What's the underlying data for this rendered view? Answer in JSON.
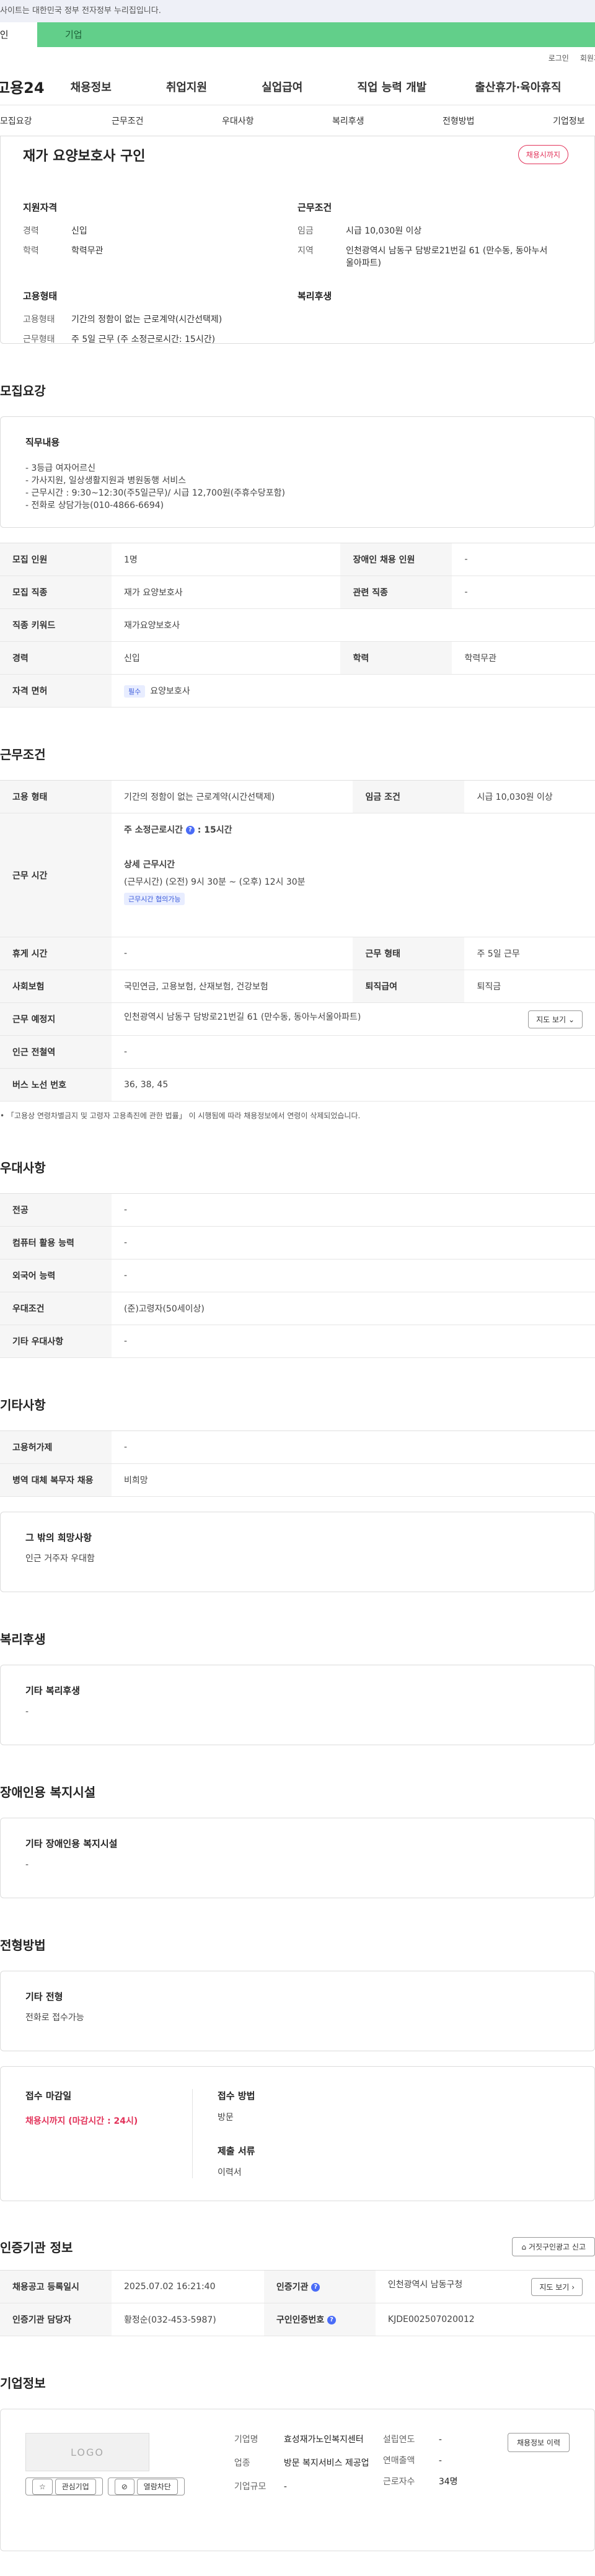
{
  "gov_notice": "사이트는 대한민국 정부 전자정부 누리집입니다.",
  "tabs": {
    "personal": "개인",
    "company": "기업"
  },
  "utility": {
    "login": "로그인",
    "signup": "회원가입"
  },
  "gnb": {
    "logo": "고용24",
    "menu": [
      "채용정보",
      "취업지원",
      "실업급여",
      "직업 능력 개발",
      "출산휴가·육아휴직"
    ]
  },
  "snb": [
    "모집요강",
    "근무조건",
    "우대사항",
    "복리후생",
    "전형방법",
    "기업정보"
  ],
  "summary": {
    "title": "재가 요양보호사 구인",
    "status": "채용시까지",
    "qualification": {
      "heading": "지원자격",
      "rows": [
        {
          "k": "경력",
          "v": "신입"
        },
        {
          "k": "학력",
          "v": "학력무관"
        }
      ]
    },
    "conditions": {
      "heading": "근무조건",
      "rows": [
        {
          "k": "임금",
          "v": "시급 10,030원 이상"
        },
        {
          "k": "지역",
          "v": "인천광역시 남동구 담방로21번길 61 (만수동, 동아누서울아파트)"
        }
      ]
    },
    "employment": {
      "heading": "고용형태",
      "rows": [
        {
          "k": "고용형태",
          "v": "기간의 정함이 없는 근로계약(시간선택제)"
        },
        {
          "k": "근무형태",
          "v": "주 5일 근무 (주 소정근로시간: 15시간)"
        }
      ]
    },
    "welfare_heading": "복리후생"
  },
  "recruit": {
    "section": "모집요강",
    "job_title": "직무내용",
    "job_text": "- 3등급 여자어르신\n- 가사지원, 일상생활지원과 병원동행 서비스\n- 근무시간 : 9:30~12:30(주5일근무)/ 시급 12,700원(주휴수당포함)\n- 전화로 상담가능(010-4866-6694)",
    "rows": [
      {
        "k1": "모집 인원",
        "v1": "1명",
        "k2": "장애인 채용 인원",
        "v2": "-"
      },
      {
        "k1": "모집 직종",
        "v1": "재가 요양보호사",
        "k2": "관련 직종",
        "v2": "-"
      }
    ],
    "keyword_label": "직종 키워드",
    "keyword": "재가요양보호사",
    "career_label": "경력",
    "career": "신입",
    "edu_label": "학력",
    "edu": "학력무관",
    "license_label": "자격 면허",
    "license_chip": "필수",
    "license": "요양보호사"
  },
  "work": {
    "section": "근무조건",
    "emp_label": "고용 형태",
    "emp": "기간의 정함이 없는 근로계약(시간선택제)",
    "wage_label": "임금 조건",
    "wage": "시급 10,030원 이상",
    "hours_label": "근무 시간",
    "hours_weekly_label": "주 소정근로시간",
    "hours_weekly": "15시간",
    "hours_detail_label": "상세 근무시간",
    "hours_detail": "(근무시간) (오전) 9시 30분 ~ (오후) 12시 30분",
    "hours_chip": "근무시간 협의가능",
    "rest_label": "휴게 시간",
    "rest": "-",
    "type_label": "근무 형태",
    "type": "주 5일 근무",
    "insurance_label": "사회보험",
    "insurance": "국민연금, 고용보험, 산재보험, 건강보험",
    "retire_label": "퇴직급여",
    "retire": "퇴직금",
    "place_label": "근무 예정지",
    "place": "인천광역시 남동구 담방로21번길 61 (만수동, 동아누서울아파트)",
    "map_btn": "지도 보기",
    "subway_label": "인근 전철역",
    "subway": "-",
    "bus_label": "버스 노선 번호",
    "bus": "36, 38, 45",
    "note": "「고용상 연령차별금지 및 고령자 고용촉진에 관한 법률」 이 시행됨에 따라 채용정보에서 연령이 삭제되었습니다."
  },
  "pref": {
    "section": "우대사항",
    "rows": [
      {
        "k": "전공",
        "v": "-"
      },
      {
        "k": "컴퓨터 활용 능력",
        "v": "-"
      },
      {
        "k": "외국어 능력",
        "v": "-"
      },
      {
        "k": "우대조건",
        "v": "(준)고령자(50세이상)"
      },
      {
        "k": "기타 우대사항",
        "v": "-"
      }
    ]
  },
  "etc": {
    "section": "기타사항",
    "rows": [
      {
        "k": "고용허가제",
        "v": "-"
      },
      {
        "k": "병역 대체 복무자 채용",
        "v": "비희망"
      }
    ],
    "wish_title": "그 밖의 희망사항",
    "wish_text": "인근 거주자 우대함"
  },
  "welfare": {
    "section": "복리후생",
    "title": "기타 복리후생",
    "text": "-"
  },
  "disability": {
    "section": "장애인용 복지시설",
    "title": "기타 장애인용 복지시설",
    "text": "-"
  },
  "selection": {
    "section": "전형방법",
    "title": "기타 전형",
    "text": "전화로 접수가능",
    "deadline_label": "접수 마감일",
    "deadline": "채용시까지 (마감시간 : 24시)",
    "method_label": "접수 방법",
    "method": "방문",
    "docs_label": "제출 서류",
    "docs": "이력서"
  },
  "cert": {
    "section": "인증기관 정보",
    "report_btn": "거짓구인광고 신고",
    "reg_label": "채용공고 등록일시",
    "reg": "2025.07.02 16:21:40",
    "org_label": "인증기관",
    "org": "인천광역시 남동구청",
    "map_btn": "지도 보기",
    "mgr_label": "인증기관 담당자",
    "mgr": "황정순(032-453-5987)",
    "id_label": "구인인증번호",
    "id": "KJDE002507020012"
  },
  "company": {
    "section": "기업정보",
    "logo": "LOGO",
    "interest_btn": "관심기업",
    "block_btn": "열람차단",
    "name_label": "기업명",
    "name": "효성재가노인복지센터",
    "industry_label": "업종",
    "industry": "방문 복지서비스 제공업",
    "size_label": "기업규모",
    "size": "-",
    "founded_label": "설립연도",
    "founded": "-",
    "sales_label": "연매출액",
    "sales": "-",
    "employees_label": "근로자수",
    "employees": "34명",
    "history_btn": "채용정보 이력"
  }
}
